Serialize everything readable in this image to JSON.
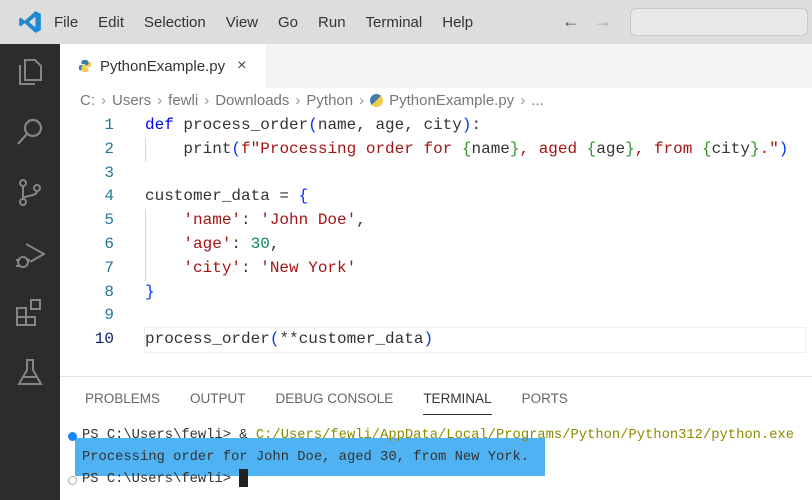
{
  "menu": [
    "File",
    "Edit",
    "Selection",
    "View",
    "Go",
    "Run",
    "Terminal",
    "Help"
  ],
  "tab": {
    "label": "PythonExample.py",
    "close": "×"
  },
  "breadcrumbs": [
    "C:",
    "Users",
    "fewli",
    "Downloads",
    "Python",
    "PythonExample.py",
    "..."
  ],
  "code": [
    {
      "n": "1",
      "t": [
        [
          "kw",
          "def "
        ],
        [
          "fn",
          "process_order"
        ],
        [
          "br1",
          "("
        ],
        [
          "",
          "name, age, city"
        ],
        [
          "br1",
          ")"
        ],
        [
          "",
          ":"
        ]
      ]
    },
    {
      "n": "2",
      "g": 1,
      "t": [
        [
          "",
          "    print"
        ],
        [
          "br1",
          "("
        ],
        [
          "str",
          "f\"Processing order for "
        ],
        [
          "br2",
          "{"
        ],
        [
          "",
          "name"
        ],
        [
          "br2",
          "}"
        ],
        [
          "str",
          ", aged "
        ],
        [
          "br2",
          "{"
        ],
        [
          "",
          "age"
        ],
        [
          "br2",
          "}"
        ],
        [
          "str",
          ", from "
        ],
        [
          "br2",
          "{"
        ],
        [
          "",
          "city"
        ],
        [
          "br2",
          "}"
        ],
        [
          "str",
          ".\""
        ],
        [
          "br1",
          ")"
        ]
      ]
    },
    {
      "n": "3",
      "t": []
    },
    {
      "n": "4",
      "t": [
        [
          "",
          "customer_data = "
        ],
        [
          "br1",
          "{"
        ]
      ]
    },
    {
      "n": "5",
      "g": 1,
      "t": [
        [
          "",
          "    "
        ],
        [
          "str",
          "'name'"
        ],
        [
          "",
          ": "
        ],
        [
          "str",
          "'John Doe'"
        ],
        [
          "",
          ","
        ]
      ]
    },
    {
      "n": "6",
      "g": 1,
      "t": [
        [
          "",
          "    "
        ],
        [
          "str",
          "'age'"
        ],
        [
          "",
          ": "
        ],
        [
          "num",
          "30"
        ],
        [
          "",
          ","
        ]
      ]
    },
    {
      "n": "7",
      "g": 1,
      "t": [
        [
          "",
          "    "
        ],
        [
          "str",
          "'city'"
        ],
        [
          "",
          ": "
        ],
        [
          "str",
          "'New York'"
        ]
      ]
    },
    {
      "n": "8",
      "t": [
        [
          "br1",
          "}"
        ]
      ]
    },
    {
      "n": "9",
      "t": []
    },
    {
      "n": "10",
      "cur": 1,
      "t": [
        [
          "",
          "process_order"
        ],
        [
          "br1",
          "("
        ],
        [
          "",
          "**customer_data"
        ],
        [
          "br1",
          ")"
        ]
      ]
    }
  ],
  "panel_tabs": [
    "PROBLEMS",
    "OUTPUT",
    "DEBUG CONSOLE",
    "TERMINAL",
    "PORTS"
  ],
  "terminal": {
    "prompt1": "PS C:\\Users\\fewli> & ",
    "cmd": "C:/Users/fewli/AppData/Local/Programs/Python/Python312/python.exe",
    "output": "Processing order for John Doe, aged 30, from New York.",
    "prompt2": "PS C:\\Users\\fewli> "
  },
  "colors": {
    "accent": "#007acc",
    "selection": "#4fb2f2"
  }
}
